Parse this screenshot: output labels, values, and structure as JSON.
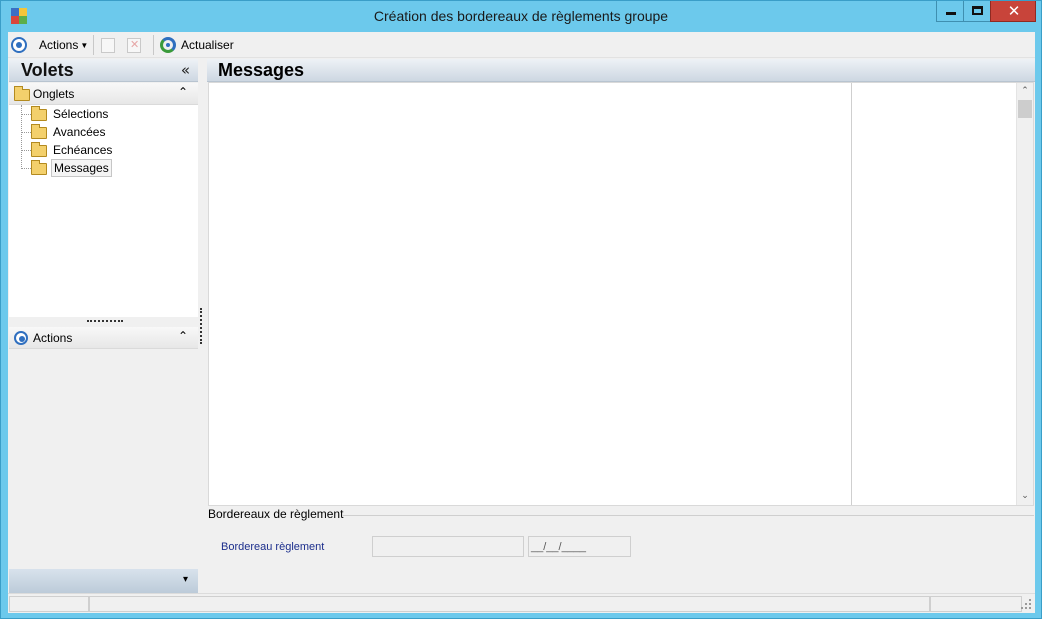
{
  "window": {
    "title": "Création des bordereaux de règlements groupe",
    "close_glyph": "✕"
  },
  "toolbar": {
    "actions_label": "Actions",
    "refresh_label": "Actualiser"
  },
  "left_panel": {
    "title": "Volets",
    "collapse_glyph": "«",
    "onglets_group": {
      "label": "Onglets",
      "chevron": "⌃",
      "items": [
        {
          "label": "Sélections",
          "selected": false
        },
        {
          "label": "Avancées",
          "selected": false
        },
        {
          "label": "Echéances",
          "selected": false
        },
        {
          "label": "Messages",
          "selected": true
        }
      ]
    },
    "actions_group": {
      "label": "Actions",
      "chevron": "⌃"
    },
    "bottom_chevron": "▾"
  },
  "main": {
    "title": "Messages",
    "scroll_up": "⌃",
    "scroll_down": "⌄",
    "fieldset": {
      "legend": "Bordereaux de règlement",
      "field_label": "Bordereau règlement",
      "field_value": "",
      "date_value": "__/__/____"
    }
  },
  "icons": {
    "app": "app-icon",
    "actions": "target-icon",
    "refresh": "refresh-icon",
    "new": "new-document-icon",
    "delete": "delete-icon",
    "folder": "folder-icon"
  },
  "colors": {
    "window_frame": "#6cc9ec",
    "close_button": "#c8443a",
    "header_gradient_top": "#eef2f6",
    "header_gradient_bottom": "#cdd7e2",
    "field_label": "#1c2e8c"
  }
}
